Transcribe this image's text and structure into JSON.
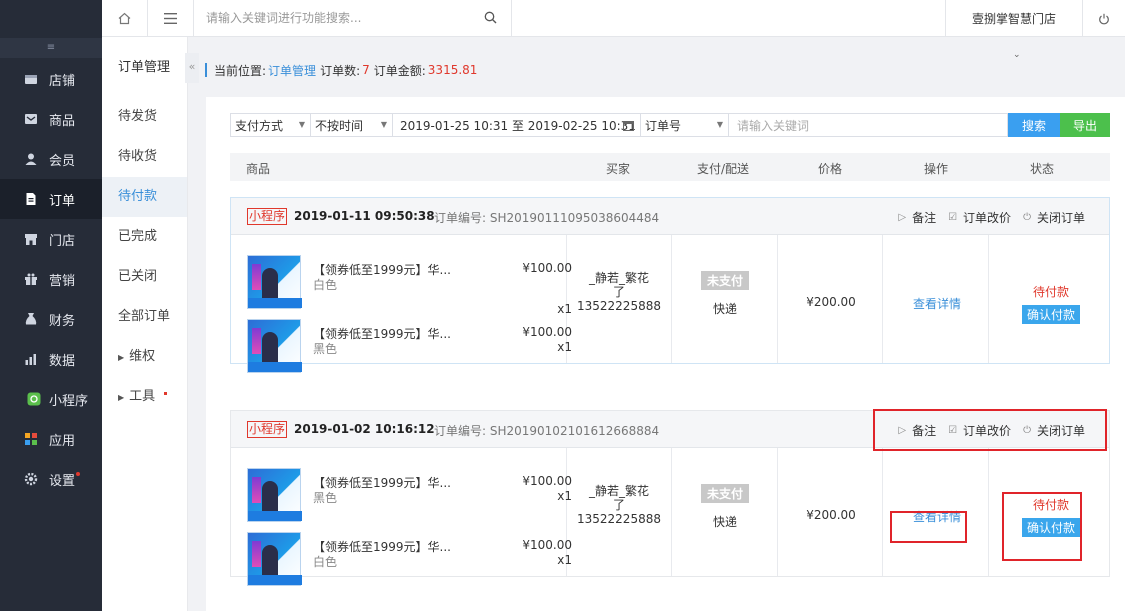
{
  "topbar": {
    "search_placeholder": "请输入关键词进行功能搜索...",
    "store_name": "壹捌掌智慧门店"
  },
  "sidebar": {
    "items": [
      {
        "label": "店铺",
        "icon": "store-icon"
      },
      {
        "label": "商品",
        "icon": "goods-icon"
      },
      {
        "label": "会员",
        "icon": "member-icon"
      },
      {
        "label": "订单",
        "icon": "order-icon"
      },
      {
        "label": "门店",
        "icon": "shop-icon"
      },
      {
        "label": "营销",
        "icon": "gift-icon"
      },
      {
        "label": "财务",
        "icon": "finance-icon"
      },
      {
        "label": "数据",
        "icon": "chart-icon"
      },
      {
        "label": "小程序",
        "icon": "miniprogram-icon"
      },
      {
        "label": "应用",
        "icon": "apps-icon"
      },
      {
        "label": "设置",
        "icon": "gear-icon"
      }
    ]
  },
  "subnav": {
    "title": "订单管理",
    "items": [
      {
        "label": "待发货"
      },
      {
        "label": "待收货"
      },
      {
        "label": "待付款"
      },
      {
        "label": "已完成"
      },
      {
        "label": "已关闭"
      },
      {
        "label": "全部订单"
      },
      {
        "label": "维权"
      },
      {
        "label": "工具"
      }
    ]
  },
  "breadcrumb": {
    "prefix": "当前位置:",
    "page": "订单管理",
    "count_label": "订单数:",
    "count": "7",
    "amount_label": "订单金额:",
    "amount": "3315.81"
  },
  "filters": {
    "pay_method": "支付方式",
    "time_mode": "不按时间",
    "date_range": "2019-01-25 10:31 至 2019-02-25 10:31",
    "field": "订单号",
    "keyword_placeholder": "请输入关键词",
    "search_label": "搜索",
    "export_label": "导出"
  },
  "table_headers": {
    "goods": "商品",
    "buyer": "买家",
    "pay_ship": "支付/配送",
    "price": "价格",
    "actions": "操作",
    "status": "状态"
  },
  "orders": [
    {
      "tag": "小程序",
      "date": "2019-01-11  09:50:38",
      "order_no": "订单编号: SH20190111095038604484",
      "ops": {
        "note": "备注",
        "edit_price": "订单改价",
        "close": "关闭订单"
      },
      "items": [
        {
          "name": "【领券低至1999元】华...",
          "spec": "白色",
          "price": "¥100.00",
          "qty": "x1"
        },
        {
          "name": "【领券低至1999元】华...",
          "spec": "黑色",
          "price": "¥100.00",
          "qty": "x1"
        }
      ],
      "buyer_name_1": "_静若_繁花",
      "buyer_name_2": "了",
      "buyer_phone": "13522225888",
      "pay_status": "未支付",
      "shipping": "快递",
      "total": "¥200.00",
      "detail_label": "查看详情",
      "status": "待付款",
      "confirm_label": "确认付款"
    },
    {
      "tag": "小程序",
      "date": "2019-01-02  10:16:12",
      "order_no": "订单编号: SH20190102101612668884",
      "ops": {
        "note": "备注",
        "edit_price": "订单改价",
        "close": "关闭订单"
      },
      "items": [
        {
          "name": "【领券低至1999元】华...",
          "spec": "黑色",
          "price": "¥100.00",
          "qty": "x1"
        },
        {
          "name": "【领券低至1999元】华...",
          "spec": "白色",
          "price": "¥100.00",
          "qty": "x1"
        }
      ],
      "buyer_name_1": "_静若_繁花",
      "buyer_name_2": "了",
      "buyer_phone": "13522225888",
      "pay_status": "未支付",
      "shipping": "快递",
      "total": "¥200.00",
      "detail_label": "查看详情",
      "status": "待付款",
      "confirm_label": "确认付款"
    }
  ],
  "colors": {
    "sidebar_bg": "#262c38",
    "accent_blue": "#3a8fd9",
    "accent_red": "#e0382c",
    "export_green": "#4cc04c"
  }
}
